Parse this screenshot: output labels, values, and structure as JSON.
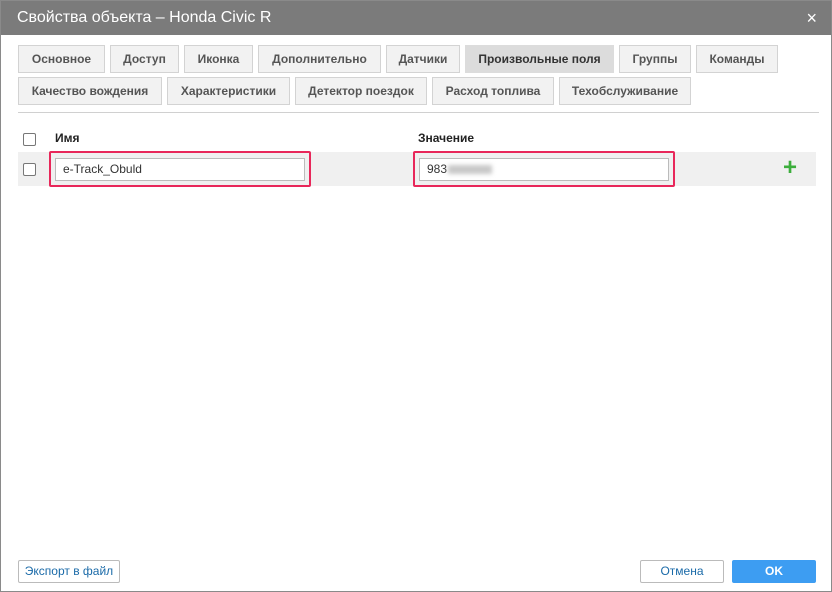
{
  "window": {
    "title": "Свойства объекта – Honda Civic R",
    "close_icon": "×"
  },
  "tabs": [
    {
      "label": "Основное"
    },
    {
      "label": "Доступ"
    },
    {
      "label": "Иконка"
    },
    {
      "label": "Дополнительно"
    },
    {
      "label": "Датчики"
    },
    {
      "label": "Произвольные поля",
      "active": true
    },
    {
      "label": "Группы"
    },
    {
      "label": "Команды"
    },
    {
      "label": "Качество вождения"
    },
    {
      "label": "Характеристики"
    },
    {
      "label": "Детектор поездок"
    },
    {
      "label": "Расход топлива"
    },
    {
      "label": "Техобслуживание"
    }
  ],
  "table": {
    "headers": {
      "name": "Имя",
      "value": "Значение"
    },
    "rows": [
      {
        "name": "e-Track_Obuld",
        "value_visible": "983"
      }
    ]
  },
  "footer": {
    "export": "Экспорт в файл",
    "cancel": "Отмена",
    "ok": "OK"
  },
  "colors": {
    "accent": "#3d9df2",
    "highlight": "#e8275a",
    "add": "#3cae3c"
  }
}
